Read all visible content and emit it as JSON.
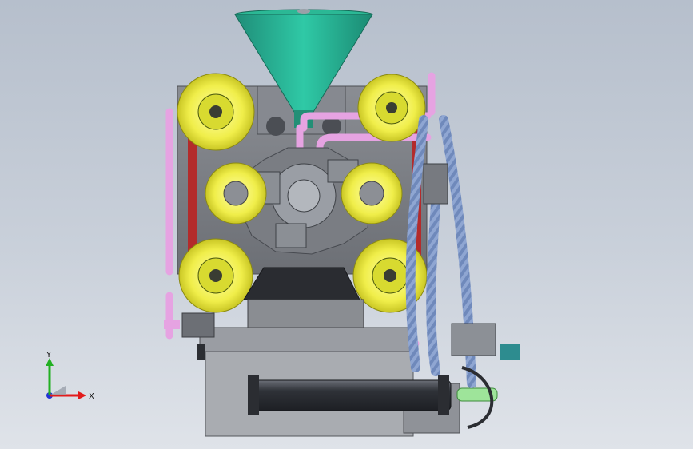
{
  "triad": {
    "x_label": "X",
    "y_label": "Y",
    "x_color": "#e21b1b",
    "y_color": "#22b022",
    "z_color": "#2233d6"
  },
  "colors": {
    "background_top": "#b6bfcc",
    "background_bottom": "#dfe3e9",
    "hopper": "#27b295",
    "pulley": "#f2f244",
    "body_gray": "#7c7f85",
    "pipe_pink": "#e7a6e5",
    "hose_blue": "#6d86b8",
    "cylinder_dark": "#3c3f46"
  }
}
